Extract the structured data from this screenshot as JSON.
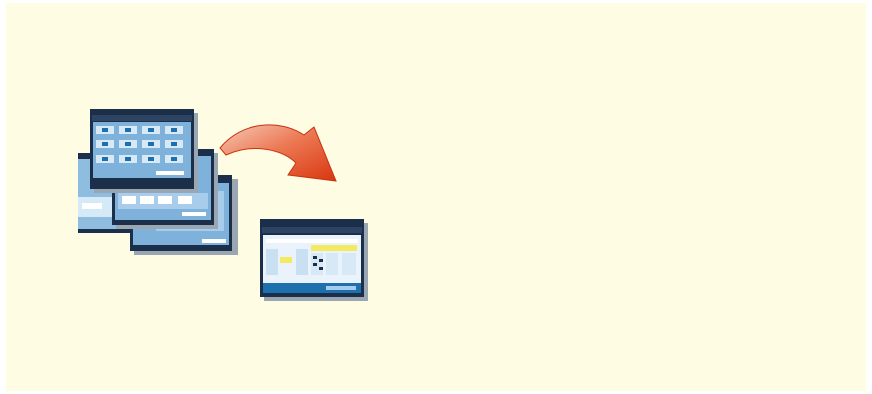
{
  "illustration": {
    "background_color": "#fefde3",
    "screen_frame_color": "#1b2f4a",
    "screen_panel_color": "#7fb2da",
    "screen_dark_color": "#1e6fae",
    "screen_yellow_color": "#f3ea62",
    "arrow_color": "#e0421d",
    "icons": [
      "stacked-screens-icon",
      "curved-arrow-icon",
      "single-screen-icon"
    ]
  }
}
